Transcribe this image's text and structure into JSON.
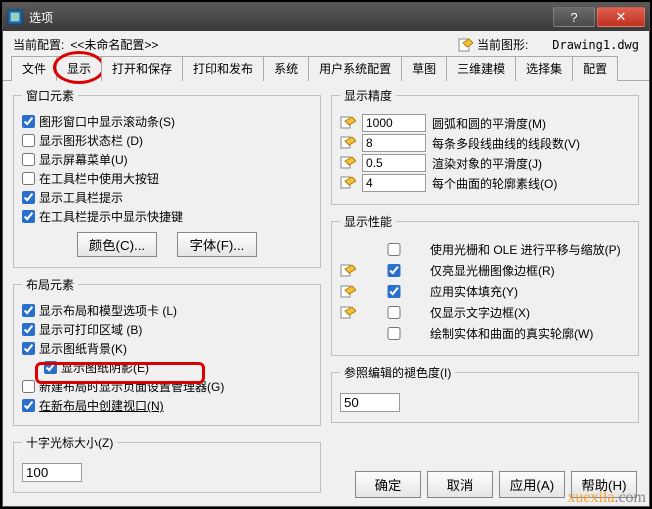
{
  "window": {
    "title": "选项"
  },
  "toprow": {
    "cur_cfg_lbl": "当前配置:",
    "cur_cfg_val": "<<未命名配置>>",
    "cur_dwg_lbl": "当前图形:",
    "drawing": "Drawing1.dwg"
  },
  "tabs": [
    "文件",
    "显示",
    "打开和保存",
    "打印和发布",
    "系统",
    "用户系统配置",
    "草图",
    "三维建模",
    "选择集",
    "配置"
  ],
  "groups": {
    "win_elems": "窗口元素",
    "layout_elems": "布局元素",
    "cross_size": "十字光标大小(Z)",
    "disp_prec": "显示精度",
    "disp_perf": "显示性能",
    "ref_fade": "参照编辑的褪色度(I)"
  },
  "win": {
    "scroll": "图形窗口中显示滚动条(S)",
    "statusbar": "显示图形状态栏 (D)",
    "screenmenu": "显示屏幕菜单(U)",
    "bigbtn": "在工具栏中使用大按钮",
    "tooltip": "显示工具栏提示",
    "shortcut": "在工具栏提示中显示快捷键",
    "color_btn": "颜色(C)...",
    "font_btn": "字体(F)..."
  },
  "layout": {
    "tabs": "显示布局和模型选项卡 (L)",
    "printable": "显示可打印区域 (B)",
    "paperbg": "显示图纸背景(K)",
    "shadow": "显示图纸阴影(E)",
    "pagemgr": "新建布局时显示页面设置管理器(G)",
    "newvp": "在新布局中创建视口(N)"
  },
  "cross": {
    "val": "100"
  },
  "prec": {
    "arc_val": "1000",
    "arc_lbl": "圆弧和圆的平滑度(M)",
    "seg_val": "8",
    "seg_lbl": "每条多段线曲线的线段数(V)",
    "rend_val": "0.5",
    "rend_lbl": "渲染对象的平滑度(J)",
    "cont_val": "4",
    "cont_lbl": "每个曲面的轮廓素线(O)"
  },
  "perf": {
    "panzoom": "使用光栅和 OLE 进行平移与缩放(P)",
    "rasterframe": "仅亮显光栅图像边框(R)",
    "solidfill": "应用实体填充(Y)",
    "textframe": "仅显示文字边框(X)",
    "truesil": "绘制实体和曲面的真实轮廓(W)"
  },
  "ref": {
    "val": "50"
  },
  "footer": {
    "ok": "确定",
    "cancel": "取消",
    "apply": "应用(A)",
    "help": "帮助(H)"
  }
}
